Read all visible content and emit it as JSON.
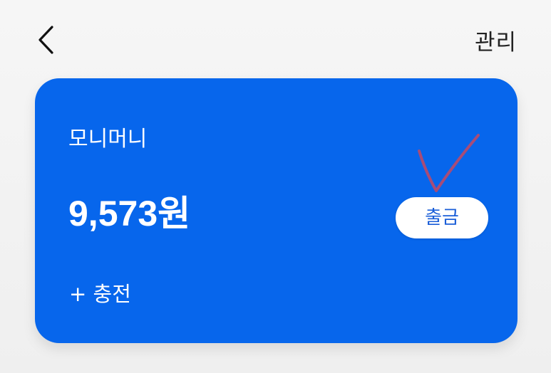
{
  "header": {
    "back_icon": "chevron-left-icon",
    "manage_label": "관리"
  },
  "card": {
    "title": "모니머니",
    "balance": "9,573원",
    "withdraw_label": "출금",
    "charge_label": "+ 충전",
    "background_color": "#0766ec",
    "button_text_color": "#1a5ed8"
  },
  "annotation": {
    "icon": "checkmark-icon",
    "color": "#b04b72"
  }
}
